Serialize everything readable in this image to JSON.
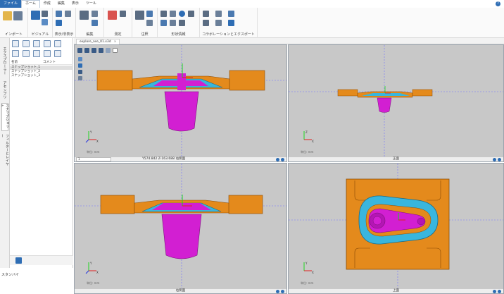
{
  "menu": {
    "items": [
      "ファイル",
      "ホーム",
      "作成",
      "編集",
      "表示",
      "ツール"
    ],
    "active_index": 1
  },
  "ribbon": {
    "groups": [
      "インポート",
      "ビジュアル",
      "表示/非表示",
      "編集",
      "測定",
      "注釈",
      "形状情報",
      "コラボレーションとエクスポート"
    ]
  },
  "left_tabs": [
    "エクスプローラー",
    "アセンブリ",
    "スナップショット",
    "フィルターとレイヤー"
  ],
  "left_panel": {
    "columns": [
      "名前",
      "コメント"
    ],
    "rows": [
      "スナップショット_1",
      "スナップショット_2",
      "スナップショット_3"
    ],
    "selected_index": 0,
    "bottom_label": "スタンバイ"
  },
  "document_tab": "explore_ase_01.x3d",
  "viewports": {
    "top_left": {
      "name": "右側面",
      "coord": "Y574.842 Z-163.688",
      "combo_value": "1",
      "unit": "単位: mm"
    },
    "top_right": {
      "name": "正面",
      "unit": "単位: mm"
    },
    "bottom_left": {
      "name": "右側面",
      "unit": "単位: mm"
    },
    "bottom_right": {
      "name": "上面",
      "unit": "単位: mm"
    }
  },
  "axis_labels": {
    "x": "X",
    "y": "Y",
    "z": "Z"
  },
  "colors": {
    "mold_orange": "#e48a1c",
    "part_magenta": "#d21fd2",
    "channel_cyan": "#39b6dd",
    "viewport_bg": "#c8c8c8",
    "accent_blue": "#2e6db4"
  }
}
